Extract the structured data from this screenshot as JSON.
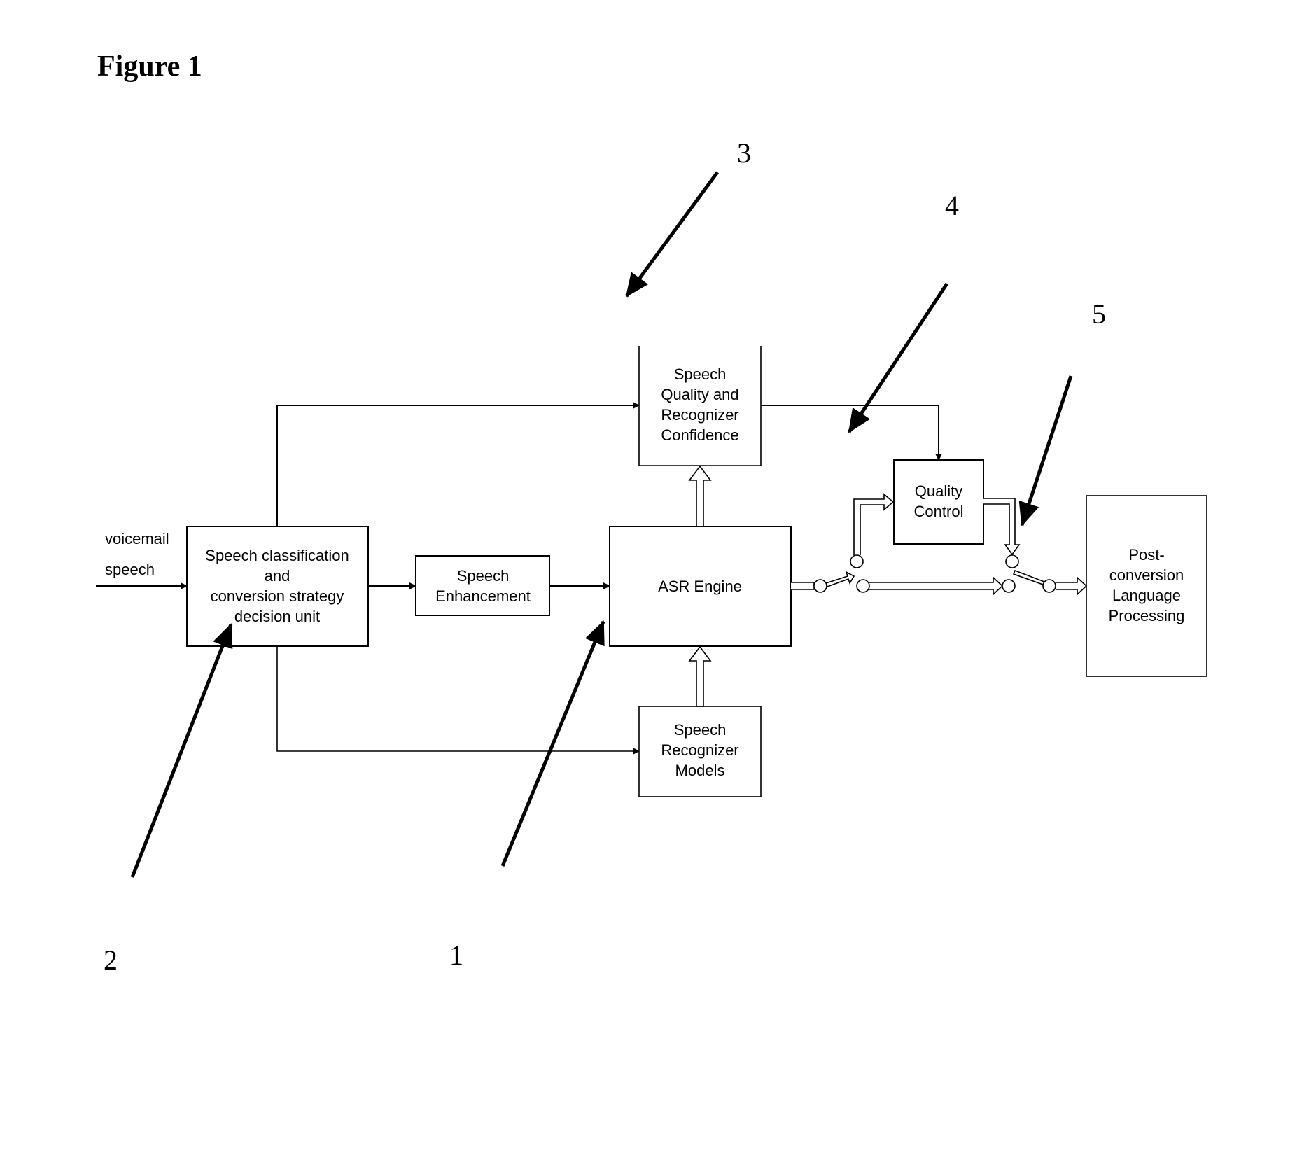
{
  "figure_title": "Figure 1",
  "input_label": [
    "voicemail",
    "speech"
  ],
  "blocks": {
    "classification": [
      "Speech classification",
      "and",
      "conversion strategy",
      "decision unit"
    ],
    "enhancement": [
      "Speech",
      "Enhancement"
    ],
    "quality_confidence": [
      "Speech",
      "Quality and",
      "Recognizer",
      "Confidence"
    ],
    "asr": [
      "ASR Engine"
    ],
    "models": [
      "Speech",
      "Recognizer",
      "Models"
    ],
    "quality_control": [
      "Quality",
      "Control"
    ],
    "post": [
      "Post-",
      "conversion",
      "Language",
      "Processing"
    ]
  },
  "reference_numerals": {
    "n1": "1",
    "n2": "2",
    "n3": "3",
    "n4": "4",
    "n5": "5"
  }
}
